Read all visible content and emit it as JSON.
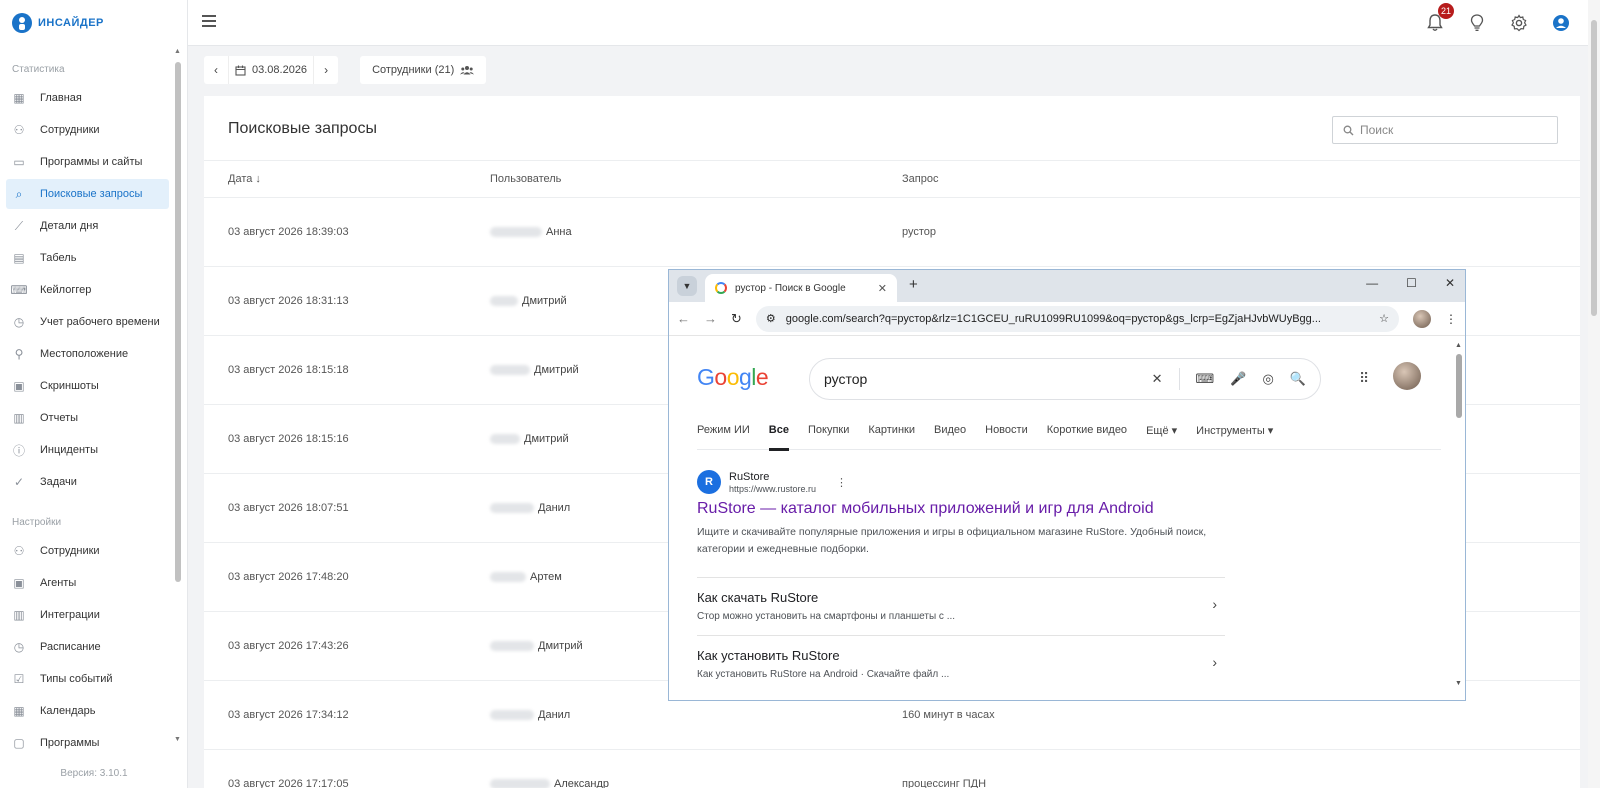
{
  "app": {
    "logo": "ИНСАЙДЕР",
    "version": "Версия: 3.10.1"
  },
  "sidebar": {
    "section_stats": "Статистика",
    "stats_items": [
      {
        "label": "Главная",
        "icon": "dashboard-icon"
      },
      {
        "label": "Сотрудники",
        "icon": "users-icon"
      },
      {
        "label": "Программы и сайты",
        "icon": "window-icon"
      },
      {
        "label": "Поисковые запросы",
        "icon": "search-icon",
        "active": true
      },
      {
        "label": "Детали дня",
        "icon": "trend-icon"
      },
      {
        "label": "Табель",
        "icon": "document-icon"
      },
      {
        "label": "Кейлоггер",
        "icon": "keyboard-icon"
      },
      {
        "label": "Учет рабочего времени",
        "icon": "clock-calendar-icon"
      },
      {
        "label": "Местоположение",
        "icon": "location-icon"
      },
      {
        "label": "Скриншоты",
        "icon": "monitor-icon"
      },
      {
        "label": "Отчеты",
        "icon": "report-icon"
      },
      {
        "label": "Инциденты",
        "icon": "alert-icon"
      },
      {
        "label": "Задачи",
        "icon": "check-circle-icon"
      }
    ],
    "section_settings": "Настройки",
    "settings_items": [
      {
        "label": "Сотрудники",
        "icon": "user-settings-icon"
      },
      {
        "label": "Агенты",
        "icon": "agent-monitor-icon"
      },
      {
        "label": "Интеграции",
        "icon": "building-icon"
      },
      {
        "label": "Расписание",
        "icon": "schedule-icon"
      },
      {
        "label": "Типы событий",
        "icon": "event-check-icon"
      },
      {
        "label": "Календарь",
        "icon": "calendar-icon"
      },
      {
        "label": "Программы",
        "icon": "programs-icon"
      }
    ]
  },
  "topbar": {
    "notifications_count": "21"
  },
  "filters": {
    "date": "03.08.2026",
    "employees": "Сотрудники (21)"
  },
  "main": {
    "title": "Поисковые запросы",
    "search_placeholder": "Поиск",
    "columns": {
      "date": "Дата ↓",
      "user": "Пользователь",
      "query": "Запрос"
    },
    "rows": [
      {
        "date": "03 август 2026 18:39:03",
        "user": "Анна",
        "query": "рустор"
      },
      {
        "date": "03 август 2026 18:31:13",
        "user": "Дмитрий",
        "query": ""
      },
      {
        "date": "03 август 2026 18:15:18",
        "user": "Дмитрий",
        "query": ""
      },
      {
        "date": "03 август 2026 18:15:16",
        "user": "Дмитрий",
        "query": ""
      },
      {
        "date": "03 август 2026 18:07:51",
        "user": "Данил",
        "query": ""
      },
      {
        "date": "03 август 2026 17:48:20",
        "user": "Артем",
        "query": ""
      },
      {
        "date": "03 август 2026 17:43:26",
        "user": "Дмитрий",
        "query": ""
      },
      {
        "date": "03 август 2026 17:34:12",
        "user": "Данил",
        "query": "160 минут в часах"
      },
      {
        "date": "03 август 2026 17:17:05",
        "user": "Александр",
        "query": "процессинг ПДН"
      }
    ]
  },
  "browser": {
    "tab_title": "рустор - Поиск в Google",
    "url": "google.com/search?q=рустор&rlz=1C1GCEU_ruRU1099RU1099&oq=рустор&gs_lcrp=EgZjaHJvbWUyBgg...",
    "search_query": "рустор",
    "tabs": [
      "Режим ИИ",
      "Все",
      "Покупки",
      "Картинки",
      "Видео",
      "Новости",
      "Короткие видео",
      "Ещё ▾",
      "Инструменты ▾"
    ],
    "result": {
      "site_name": "RuStore",
      "site_url": "https://www.rustore.ru",
      "title": "RuStore — каталог мобильных приложений и игр для Android",
      "snippet": "Ищите и скачивайте популярные приложения и игры в официальном магазине RuStore. Удобный поиск, категории и ежедневные подборки."
    },
    "sublinks": [
      {
        "title": "Как скачать RuStore",
        "desc": "Стор можно установить на смартфоны и планшеты с ..."
      },
      {
        "title": "Как установить RuStore",
        "desc": "Как установить RuStore на Android · Скачайте файл ..."
      }
    ]
  }
}
